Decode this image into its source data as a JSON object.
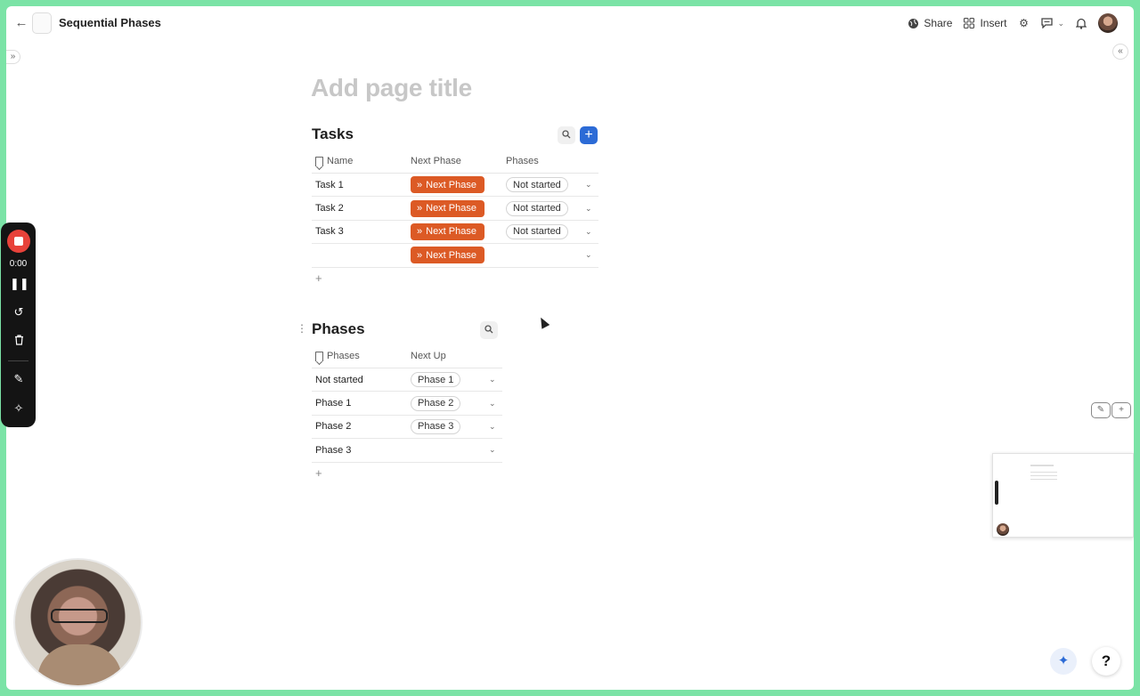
{
  "header": {
    "title": "Sequential Phases",
    "share_label": "Share",
    "insert_label": "Insert"
  },
  "page": {
    "title_placeholder": "Add page title"
  },
  "tasks": {
    "title": "Tasks",
    "columns": [
      "Name",
      "Next Phase",
      "Phases"
    ],
    "button_label": "Next Phase",
    "rows": [
      {
        "name": "Task 1",
        "phase": "Not started"
      },
      {
        "name": "Task 2",
        "phase": "Not started"
      },
      {
        "name": "Task 3",
        "phase": "Not started"
      },
      {
        "name": "",
        "phase": ""
      }
    ],
    "add_label": "+"
  },
  "phases": {
    "title": "Phases",
    "columns": [
      "Phases",
      "Next Up"
    ],
    "rows": [
      {
        "name": "Not started",
        "next": "Phase 1"
      },
      {
        "name": "Phase 1",
        "next": "Phase 2"
      },
      {
        "name": "Phase 2",
        "next": "Phase 3"
      },
      {
        "name": "Phase 3",
        "next": ""
      }
    ],
    "add_label": "+"
  },
  "recorder": {
    "time": "0:00"
  },
  "help_label": "?",
  "colors": {
    "accent": "#2c6bd6",
    "next_phase_button": "#dc5a25",
    "record": "#e8423a",
    "frame": "#7be3a6"
  },
  "icons": [
    "back-arrow-icon",
    "document-icon",
    "globe-icon",
    "grid-icon",
    "gear-icon",
    "comment-icon",
    "bell-icon",
    "search-icon",
    "plus-icon",
    "double-chevron-icon",
    "chevron-down-icon",
    "bookmark-icon",
    "pause-icon",
    "restart-icon",
    "trash-icon",
    "pencil-icon",
    "magic-wand-icon",
    "sparkle-icon",
    "help-icon"
  ]
}
